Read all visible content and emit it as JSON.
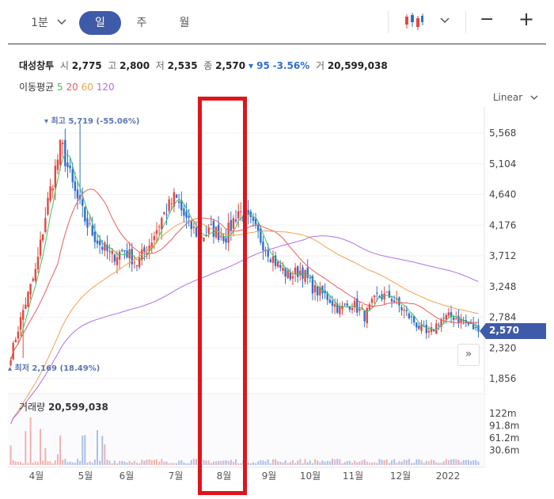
{
  "toolbar": {
    "minute_label": "1분",
    "periods": [
      "일",
      "주",
      "월"
    ],
    "active_period": "일",
    "chart_type_icon": "candlestick-icon",
    "zoom_out": "−",
    "zoom_in": "+"
  },
  "stock": {
    "name": "대성창투",
    "open_label": "시",
    "open": "2,775",
    "high_label": "고",
    "high": "2,800",
    "low_label": "저",
    "low": "2,535",
    "close_label": "종",
    "close": "2,570",
    "change": "▾ 95",
    "change_pct": "-3.56%",
    "volume_label": "거",
    "volume": "20,599,038"
  },
  "moving_average": {
    "label": "이동평균",
    "periods": [
      "5",
      "20",
      "60",
      "120"
    ]
  },
  "scale_mode": "Linear",
  "colors": {
    "up": "#e8463c",
    "down": "#2f6fd0",
    "ma5": "#3ec25d",
    "ma20": "#ef5b5b",
    "ma60": "#f2a14b",
    "ma120": "#b06ee8",
    "accent": "#3f5aa8",
    "highlight_box": "#e0141a"
  },
  "annotations": {
    "high": "▾ 최고 5,719 (-55.06%)",
    "low": "▴ 최저 2,169 (18.49%)",
    "current": "2,570"
  },
  "volume_panel": {
    "title": "거래량",
    "value": "20,599,038",
    "axis": [
      "122m",
      "91.8m",
      "61.2m",
      "30.6m"
    ]
  },
  "chart_data": {
    "type": "candlestick",
    "x_labels": [
      "4월",
      "5월",
      "6월",
      "7월",
      "8월",
      "9월",
      "10월",
      "11월",
      "12월",
      "2022"
    ],
    "y_ticks": [
      5568,
      5104,
      4640,
      4176,
      3712,
      3248,
      2784,
      2320,
      1856
    ],
    "y_tick_labels": [
      "5,568",
      "5,104",
      "4,640",
      "4,176",
      "3,712",
      "3,248",
      "2,784",
      "2,320",
      "1,856"
    ],
    "ylim": [
      1700,
      6000
    ],
    "series_close_path": [
      2200,
      2900,
      3500,
      4600,
      5400,
      4700,
      4200,
      3900,
      3700,
      3800,
      3600,
      3900,
      4300,
      4600,
      4200,
      4000,
      4100,
      4000,
      4400,
      4200,
      3900,
      3600,
      3400,
      3500,
      3200,
      3100,
      2900,
      3000,
      2800,
      3100,
      3100,
      2900,
      2700,
      2500,
      2750,
      2800,
      2700,
      2570
    ],
    "ma_legend": [
      "5",
      "20",
      "60",
      "120"
    ]
  }
}
